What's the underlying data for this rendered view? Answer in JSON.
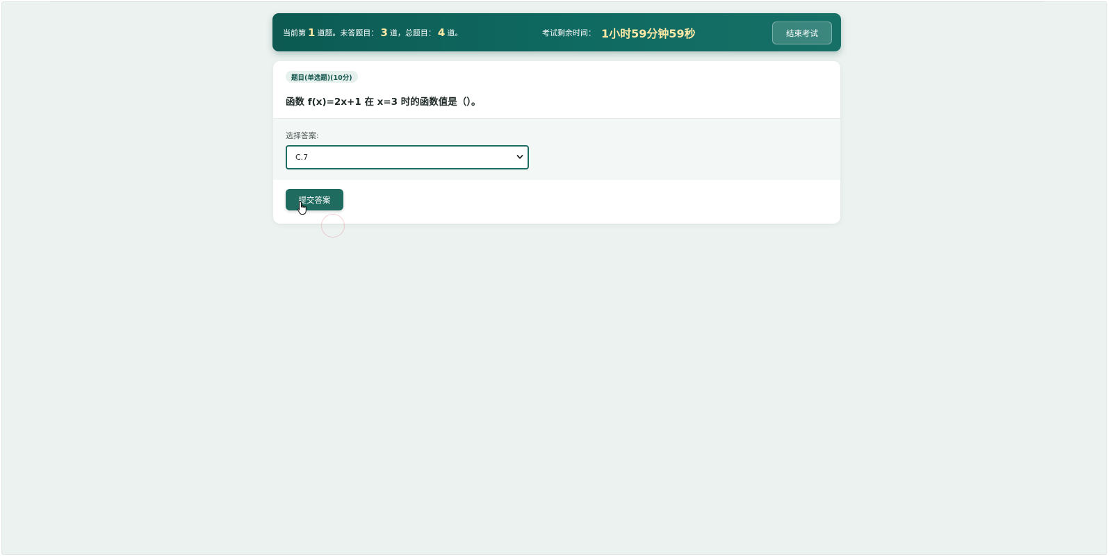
{
  "header": {
    "progress": {
      "prefix": "当前第",
      "current": "1",
      "after_current": "道题。未答题目：",
      "unanswered": "3",
      "after_unanswered": "道，总题目：",
      "total": "4",
      "suffix": "道。"
    },
    "timer_label": "考试剩余时间：",
    "timer_value": "1小时59分钟59秒",
    "end_exam_label": "结束考试"
  },
  "question": {
    "tag": "题目(单选题)(10分)",
    "text": "函数 f(x)=2x+1 在 x=3 时的函数值是（）。"
  },
  "answer": {
    "label": "选择答案:",
    "selected": "C.7"
  },
  "submit_label": "提交答案",
  "colors": {
    "header_start": "#0c5a52",
    "header_end": "#177066",
    "accent_number": "#ffe9a6",
    "button": "#206b60",
    "page_bg": "#ecf2f0"
  },
  "icons": {
    "select_arrow": "chevron-down-icon",
    "pointer": "hand-cursor-icon"
  }
}
